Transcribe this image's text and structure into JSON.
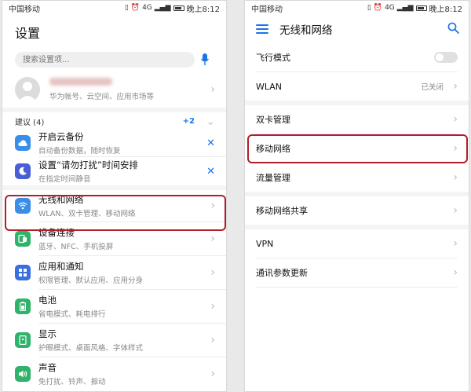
{
  "left": {
    "status": {
      "carrier": "中国移动",
      "time": "晚上8:12",
      "signal": "4G"
    },
    "title": "设置",
    "search": {
      "placeholder": "搜索设置项..."
    },
    "account": {
      "sub": "华为帐号、云空间、应用市场等"
    },
    "suggestions": {
      "label": "建议 (4)",
      "count": "+2"
    },
    "items": [
      {
        "title": "开启云备份",
        "sub": "自动备份数据，随时恢复",
        "icon": "cloud-icon",
        "color": "#3a8ee6"
      },
      {
        "title": "设置“请勿打扰”时间安排",
        "sub": "在指定时间静音",
        "icon": "moon-icon",
        "color": "#4a5fd6"
      },
      {
        "title": "无线和网络",
        "sub": "WLAN、双卡管理、移动网络",
        "icon": "wifi-icon",
        "color": "#3a8ee6"
      },
      {
        "title": "设备连接",
        "sub": "蓝牙、NFC、手机投屏",
        "icon": "device-icon",
        "color": "#2fb36b"
      },
      {
        "title": "应用和通知",
        "sub": "权限管理、默认应用、应用分身",
        "icon": "apps-icon",
        "color": "#3a6fe0"
      },
      {
        "title": "电池",
        "sub": "省电模式、耗电排行",
        "icon": "battery-icon",
        "color": "#2fb36b"
      },
      {
        "title": "显示",
        "sub": "护眼模式、桌面风格、字体样式",
        "icon": "display-icon",
        "color": "#2fb36b"
      },
      {
        "title": "声音",
        "sub": "免打扰、铃声、振动",
        "icon": "sound-icon",
        "color": "#2fb36b"
      }
    ]
  },
  "right": {
    "status": {
      "carrier": "中国移动",
      "time": "晚上8:12",
      "signal": "4G"
    },
    "title": "无线和网络",
    "rows": {
      "airplane": "飞行模式",
      "wlan": "WLAN",
      "wlan_value": "已关闭",
      "dualsim": "双卡管理",
      "mobile": "移动网络",
      "traffic": "流量管理",
      "hotspot": "移动网络共享",
      "vpn": "VPN",
      "params": "通讯参数更新"
    }
  },
  "colors": {
    "accent": "#1a73e8",
    "highlight": "#b01e2a"
  }
}
